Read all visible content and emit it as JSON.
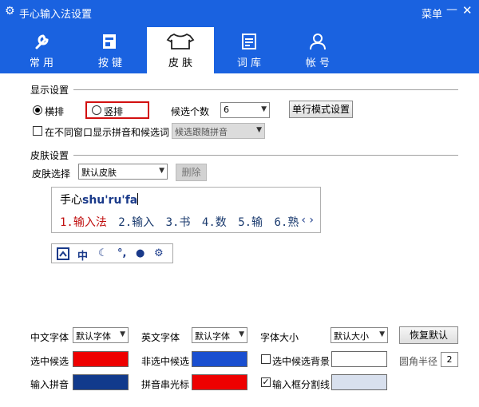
{
  "window": {
    "title": "手心输入法设置",
    "menu_label": "菜单",
    "minimize_glyph": "—",
    "close_glyph": "✕"
  },
  "tabs": [
    {
      "label": "常 用",
      "icon": "wrench-icon",
      "active": false
    },
    {
      "label": "按 键",
      "icon": "keyboard-icon",
      "active": false
    },
    {
      "label": "皮 肤",
      "icon": "shirt-icon",
      "active": true
    },
    {
      "label": "词 库",
      "icon": "dictionary-icon",
      "active": false
    },
    {
      "label": "帐 号",
      "icon": "user-icon",
      "active": false
    }
  ],
  "display": {
    "section_title": "显示设置",
    "horizontal_label": "横排",
    "vertical_label": "竖排",
    "selected": "横排",
    "candidates_label": "候选个数",
    "candidates_value": "6",
    "single_line_button": "单行模式设置",
    "separate_window_label": "在不同窗口显示拼音和候选词",
    "separate_window_checked": false,
    "follow_select": "候选跟随拼音"
  },
  "skin": {
    "section_title": "皮肤设置",
    "choose_label": "皮肤选择",
    "choose_value": "默认皮肤",
    "delete_button": "删除"
  },
  "preview": {
    "input_prefix": "手心",
    "input_pinyin": "shu'ru'fa",
    "candidates": [
      "1.输入法",
      "2.输入",
      "3.书",
      "4.数",
      "5.输",
      "6.熟"
    ],
    "prev_glyph": "‹",
    "next_glyph": "›"
  },
  "status_toolbar": {
    "icons": [
      "keyboard-icon",
      "chinese-mode-icon",
      "moon-icon",
      "punctuation-icon",
      "user-icon",
      "gear-icon"
    ],
    "mode_text": "中"
  },
  "fonts": {
    "chinese_label": "中文字体",
    "chinese_value": "默认字体",
    "english_label": "英文字体",
    "english_value": "默认字体",
    "size_label": "字体大小",
    "size_value": "默认大小",
    "restore_button": "恢复默认"
  },
  "colors": {
    "selected_candidate_label": "选中候选",
    "selected_candidate_color": "#ee0000",
    "unselected_candidate_label": "非选中候选",
    "unselected_candidate_color": "#1a4fd0",
    "selected_bg_label": "选中候选背景",
    "selected_bg_checked": false,
    "selected_bg_color": "#ffffff",
    "radius_label": "圆角半径",
    "radius_value": "2",
    "input_pinyin_label": "输入拼音",
    "input_pinyin_color": "#113a8c",
    "caret_label": "拼音串光标",
    "caret_color": "#ee0000",
    "divider_label": "输入框分割线",
    "divider_checked": true,
    "divider_color": "#d8e0ee"
  }
}
